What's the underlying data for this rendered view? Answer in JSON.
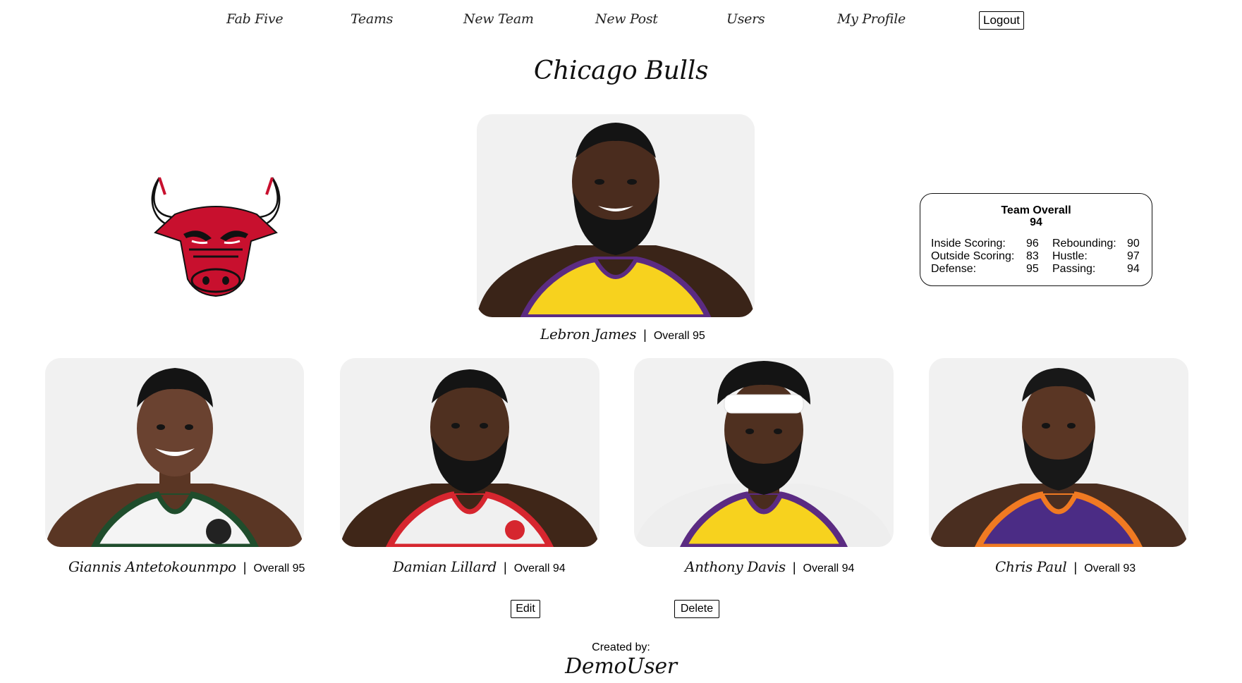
{
  "nav": {
    "items": [
      {
        "label": "Fab Five"
      },
      {
        "label": "Teams"
      },
      {
        "label": "New Team"
      },
      {
        "label": "New Post"
      },
      {
        "label": "Users"
      },
      {
        "label": "My Profile"
      }
    ],
    "logout_label": "Logout"
  },
  "team": {
    "name": "Chicago Bulls",
    "logo_icon": "chicago-bulls-logo"
  },
  "featured_player": {
    "name": "Lebron James",
    "overall": "Overall 95",
    "jersey_color": "#f7d21e",
    "jersey_trim": "#5b2b82"
  },
  "players": [
    {
      "name": "Giannis Antetokounmpo",
      "overall": "Overall 95",
      "jersey_color": "#f4f4f4",
      "jersey_trim": "#1f4d2c"
    },
    {
      "name": "Damian Lillard",
      "overall": "Overall 94",
      "jersey_color": "#f0f0f0",
      "jersey_trim": "#d6262f"
    },
    {
      "name": "Anthony Davis",
      "overall": "Overall 94",
      "jersey_color": "#f7d21e",
      "jersey_trim": "#5b2b82"
    },
    {
      "name": "Chris Paul",
      "overall": "Overall 93",
      "jersey_color": "#4b2c85",
      "jersey_trim": "#f07a22"
    }
  ],
  "separator": "|",
  "team_overall": {
    "title": "Team Overall",
    "value": "94",
    "stats": [
      {
        "label": "Inside Scoring:",
        "value": "96"
      },
      {
        "label": "Outside Scoring:",
        "value": "83"
      },
      {
        "label": "Defense:",
        "value": "95"
      },
      {
        "label": "Rebounding:",
        "value": "90"
      },
      {
        "label": "Hustle:",
        "value": "97"
      },
      {
        "label": "Passing:",
        "value": "94"
      }
    ]
  },
  "actions": {
    "edit_label": "Edit",
    "delete_label": "Delete"
  },
  "footer": {
    "created_by_label": "Created by:",
    "creator": "DemoUser"
  }
}
